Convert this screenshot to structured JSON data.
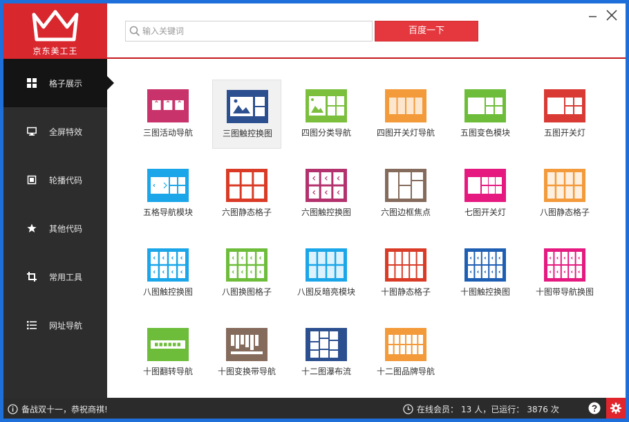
{
  "app": {
    "name": "京东美工王",
    "brand_color": "#d9272e"
  },
  "header": {
    "search_placeholder": "输入关键词",
    "search_button": "百度一下"
  },
  "sidebar": {
    "items": [
      {
        "label": "格子展示",
        "icon": "grid-icon",
        "active": true
      },
      {
        "label": "全屏特效",
        "icon": "monitor-icon",
        "active": false
      },
      {
        "label": "轮播代码",
        "icon": "frame-icon",
        "active": false
      },
      {
        "label": "其他代码",
        "icon": "star-icon",
        "active": false
      },
      {
        "label": "常用工具",
        "icon": "crop-icon",
        "active": false
      },
      {
        "label": "网址导航",
        "icon": "list-icon",
        "active": false
      }
    ]
  },
  "tiles": [
    {
      "label": "三图活动导航",
      "color": "#c8336b",
      "kind": "arrows3"
    },
    {
      "label": "三图触控换图",
      "color": "#2b4f8f",
      "kind": "img-side",
      "selected": true
    },
    {
      "label": "四图分类导航",
      "color": "#7bbf3d",
      "kind": "img-grid"
    },
    {
      "label": "四图开关灯导航",
      "color": "#f39a3a",
      "kind": "bars4"
    },
    {
      "label": "五图变色模块",
      "color": "#6dbd3a",
      "kind": "blocks5"
    },
    {
      "label": "五图开关灯",
      "color": "#d93b34",
      "kind": "blocks5"
    },
    {
      "label": "五格导航模块",
      "color": "#1aa6e8",
      "kind": "nav-grid"
    },
    {
      "label": "六图静态格子",
      "color": "#d93b26",
      "kind": "grid6"
    },
    {
      "label": "六图触控换图",
      "color": "#b3326d",
      "kind": "arrows6"
    },
    {
      "label": "六图边框焦点",
      "color": "#856b5c",
      "kind": "border6"
    },
    {
      "label": "七图开关灯",
      "color": "#e5197f",
      "kind": "blocks7"
    },
    {
      "label": "八图静态格子",
      "color": "#f39a3a",
      "kind": "grid8"
    },
    {
      "label": "八图触控换图",
      "color": "#1aa6e8",
      "kind": "arrows8"
    },
    {
      "label": "八图换图格子",
      "color": "#6dbd3a",
      "kind": "arrows8"
    },
    {
      "label": "八图反暗亮模块",
      "color": "#1aa6e8",
      "kind": "grid8"
    },
    {
      "label": "十图静态格子",
      "color": "#d93b26",
      "kind": "grid10"
    },
    {
      "label": "十图触控换图",
      "color": "#1e5fb4",
      "kind": "arrows10"
    },
    {
      "label": "十图带导航换图",
      "color": "#e5197f",
      "kind": "arrows10"
    },
    {
      "label": "十图翻转导航",
      "color": "#6dbd3a",
      "kind": "dots-nav"
    },
    {
      "label": "十图变换带导航",
      "color": "#856b5c",
      "kind": "vbars"
    },
    {
      "label": "十二图瀑布流",
      "color": "#2b4f8f",
      "kind": "waterfall"
    },
    {
      "label": "十二图品牌导航",
      "color": "#f39a3a",
      "kind": "grid12"
    }
  ],
  "status": {
    "message": "备战双十一，恭祝商祺!",
    "online_label": "在线会员：",
    "online_count": "13",
    "online_unit": "人，已运行：",
    "run_count": "3876",
    "run_unit": "次"
  }
}
